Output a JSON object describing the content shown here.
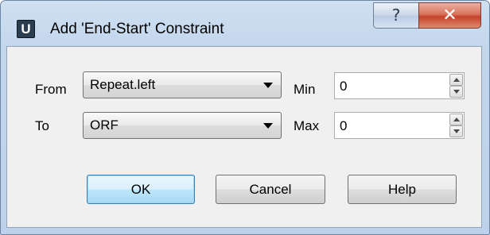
{
  "window": {
    "title": "Add 'End-Start' Constraint",
    "icon_letter": "U",
    "help_glyph": "?",
    "close_glyph": "✕"
  },
  "form": {
    "from_label": "From",
    "from_value": "Repeat.left",
    "to_label": "To",
    "to_value": "ORF",
    "min_label": "Min",
    "min_value": "0",
    "max_label": "Max",
    "max_value": "0"
  },
  "buttons": {
    "ok": "OK",
    "cancel": "Cancel",
    "help": "Help"
  },
  "colors": {
    "title_bar": "#c3d6ec",
    "close_button": "#c7412a",
    "default_button": "#bee6fd"
  }
}
